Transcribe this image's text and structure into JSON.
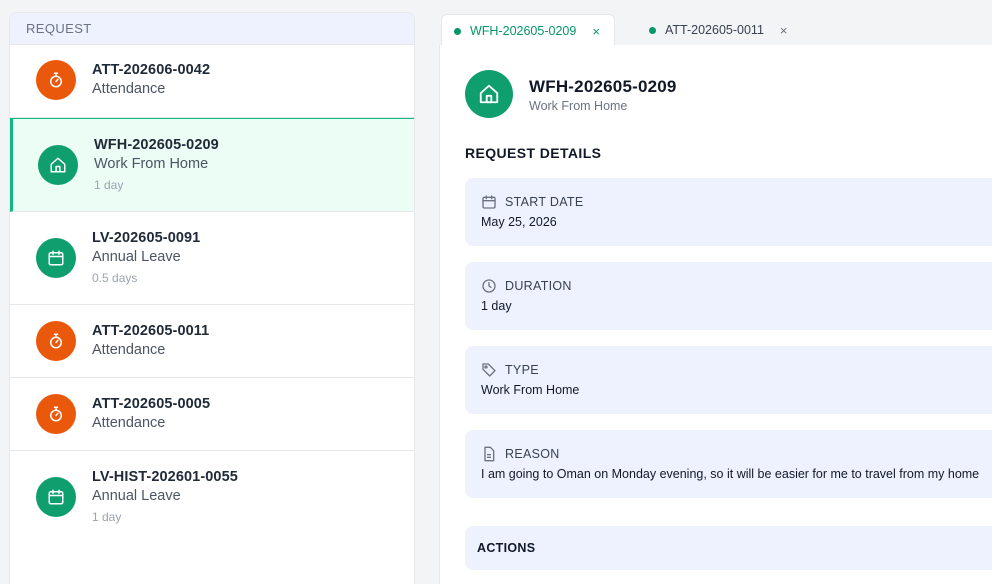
{
  "list": {
    "header": "REQUEST",
    "items": [
      {
        "id": "ATT-202606-0042",
        "type": "Attendance",
        "duration": "",
        "icon": "stopwatch-icon",
        "color": "#ea580c"
      },
      {
        "id": "WFH-202605-0209",
        "type": "Work From Home",
        "duration": "1 day",
        "icon": "home-icon",
        "color": "#0f9f6e"
      },
      {
        "id": "LV-202605-0091",
        "type": "Annual Leave",
        "duration": "0.5 days",
        "icon": "calendar-icon",
        "color": "#0f9f6e"
      },
      {
        "id": "ATT-202605-0011",
        "type": "Attendance",
        "duration": "",
        "icon": "stopwatch-icon",
        "color": "#ea580c"
      },
      {
        "id": "ATT-202605-0005",
        "type": "Attendance",
        "duration": "",
        "icon": "stopwatch-icon",
        "color": "#ea580c"
      },
      {
        "id": "LV-HIST-202601-0055",
        "type": "Annual Leave",
        "duration": "1 day",
        "icon": "calendar-icon",
        "color": "#0f9f6e"
      }
    ]
  },
  "tabs": [
    {
      "label": "WFH-202605-0209",
      "close": "×"
    },
    {
      "label": "ATT-202605-0011",
      "close": "×"
    }
  ],
  "detail": {
    "title": "WFH-202605-0209",
    "subtitle": "Work From Home",
    "section_title": "REQUEST DETAILS",
    "start_date": {
      "label": "START DATE",
      "value": "May 25, 2026"
    },
    "duration": {
      "label": "DURATION",
      "value": "1 day"
    },
    "type": {
      "label": "TYPE",
      "value": "Work From Home"
    },
    "reason": {
      "label": "REASON",
      "value": "I am going to Oman on Monday evening, so it will be easier for me to travel from my home"
    },
    "actions": {
      "label": "ACTIONS"
    }
  },
  "colors": {
    "accent": "#10b981",
    "orange": "#ea580c",
    "green": "#0f9f6e",
    "card_bg": "#eef2ff"
  }
}
